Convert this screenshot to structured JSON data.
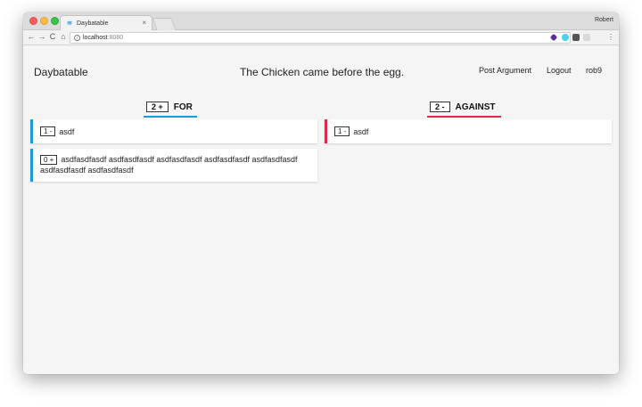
{
  "browser": {
    "tab_title": "Daybatable",
    "tab_favicon": "≋",
    "profile_name": "Robert",
    "url_host": "localhost",
    "url_port": ":8080",
    "nav": {
      "back": "←",
      "forward": "→",
      "reload": "C",
      "home": "⌂"
    },
    "close_glyph": "×",
    "zoom_glyph": "⌕",
    "menu_glyph": "⋮"
  },
  "header": {
    "brand": "Daybatable",
    "topic": "The Chicken came before the egg.",
    "post_argument": "Post Argument",
    "logout": "Logout",
    "username": "rob9"
  },
  "columns": {
    "for": {
      "score": "2 +",
      "label": "FOR",
      "color": "#1a9dd9"
    },
    "against": {
      "score": "2 -",
      "label": "AGAINST",
      "color": "#e0284a"
    }
  },
  "arguments": {
    "for": [
      {
        "votes": "1 -",
        "text": "asdf"
      },
      {
        "votes": "0 +",
        "text": "asdfasdfasdf asdfasdfasdf asdfasdfasdf asdfasdfasdf asdfasdfasdf asdfasdfasdf asdfasdfasdf"
      }
    ],
    "against": [
      {
        "votes": "1 -",
        "text": "asdf"
      }
    ]
  }
}
